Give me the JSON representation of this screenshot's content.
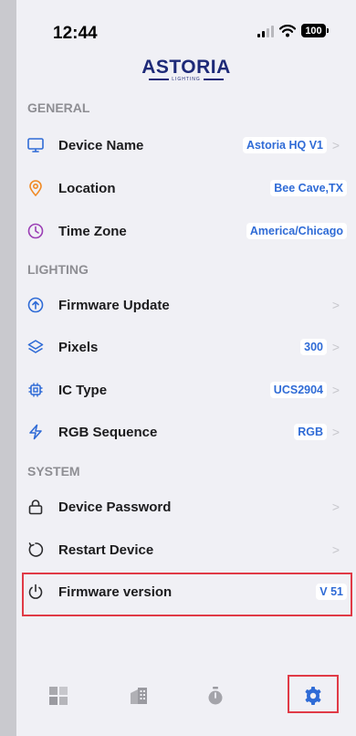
{
  "status": {
    "time": "12:44",
    "battery": "100"
  },
  "logo": {
    "word": "ASTORIA",
    "sub": "LIGHTING"
  },
  "sections": {
    "general": "GENERAL",
    "lighting": "LIGHTING",
    "system": "SYSTEM"
  },
  "rows": {
    "device_name": {
      "label": "Device Name",
      "value": "Astoria HQ V1",
      "icon": "monitor-icon"
    },
    "location": {
      "label": "Location",
      "value": "Bee Cave,TX",
      "icon": "map-pin-icon"
    },
    "time_zone": {
      "label": "Time Zone",
      "value": "America/Chicago",
      "icon": "clock-icon"
    },
    "firmware_update": {
      "label": "Firmware Update",
      "icon": "arrow-up-circle-icon"
    },
    "pixels": {
      "label": "Pixels",
      "value": "300",
      "icon": "layers-icon"
    },
    "ic_type": {
      "label": "IC Type",
      "value": "UCS2904",
      "icon": "chip-icon"
    },
    "rgb_sequence": {
      "label": "RGB Sequence",
      "value": "RGB",
      "icon": "lightning-icon"
    },
    "device_password": {
      "label": "Device Password",
      "icon": "lock-icon"
    },
    "restart_device": {
      "label": "Restart Device",
      "icon": "restart-icon"
    },
    "firmware_version": {
      "label": "Firmware version",
      "value": "V 51",
      "icon": "power-icon"
    }
  },
  "tabs": [
    "grid-icon",
    "building-icon",
    "timer-icon",
    "gear-icon"
  ],
  "colors": {
    "accent_blue": "#2f6bd6",
    "brand_navy": "#1e2a78",
    "highlight_red": "#e03a46",
    "location_orange": "#f08a24",
    "timezone_purple": "#9b3fb5"
  }
}
